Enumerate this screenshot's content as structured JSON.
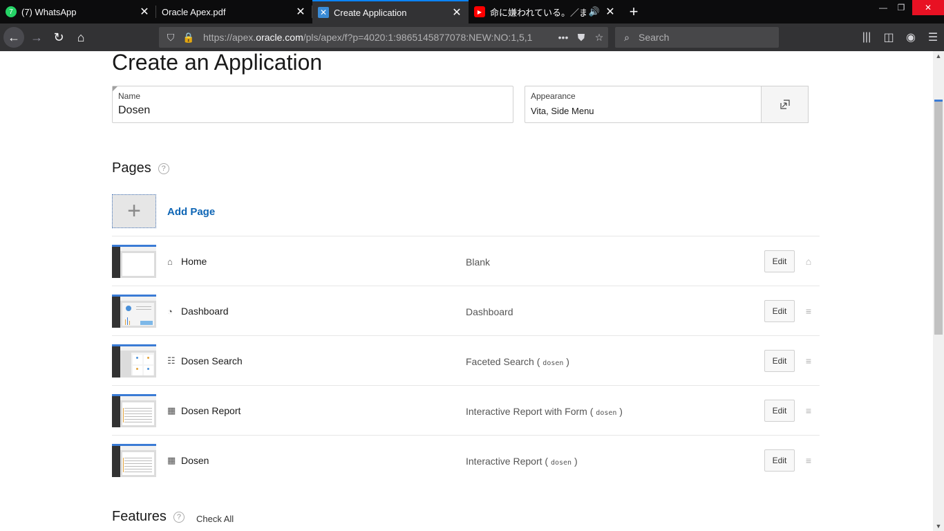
{
  "browser": {
    "tabs": [
      {
        "title": "(7) WhatsApp",
        "icon": "whatsapp-icon",
        "color": "#25d366",
        "badge": "7"
      },
      {
        "title": "Oracle Apex.pdf",
        "icon": "pdf-icon"
      },
      {
        "title": "Create Application",
        "icon": "apex-icon",
        "color": "#3a8bd6"
      },
      {
        "title": "命に嫌われている。／まふ",
        "icon": "youtube-icon",
        "color": "#ff0000"
      }
    ],
    "url_prefix": "https://apex.",
    "url_domain": "oracle.com",
    "url_rest": "/pls/apex/f?p=4020:1:9865145877078:NEW:NO:1,5,1",
    "search_placeholder": "Search"
  },
  "page": {
    "title": "Create an Application",
    "name_label": "Name",
    "name_value": "Dosen",
    "appearance_label": "Appearance",
    "appearance_value": "Vita, Side Menu",
    "pages_heading": "Pages",
    "help_glyph": "?",
    "add_page_label": "Add Page",
    "features_heading": "Features",
    "check_all_label": "Check All",
    "edit_label": "Edit",
    "rows": [
      {
        "name": "Home",
        "icon": "home-icon",
        "type": "Blank",
        "source": ""
      },
      {
        "name": "Dashboard",
        "icon": "dashboard-icon",
        "type": "Dashboard",
        "source": ""
      },
      {
        "name": "Dosen Search",
        "icon": "faceted-search-icon",
        "type": "Faceted Search",
        "source": "dosen"
      },
      {
        "name": "Dosen Report",
        "icon": "table-icon",
        "type": "Interactive Report with Form",
        "source": "dosen"
      },
      {
        "name": "Dosen",
        "icon": "table-icon",
        "type": "Interactive Report",
        "source": "dosen"
      }
    ]
  }
}
